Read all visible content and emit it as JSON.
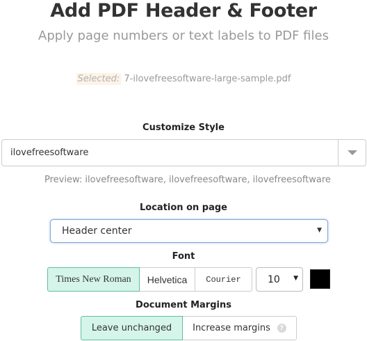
{
  "header": {
    "title": "Add PDF Header & Footer",
    "subtitle": "Apply page numbers or text labels to PDF files"
  },
  "file": {
    "selected_label": "Selected:",
    "filename": "7-ilovefreesoftware-large-sample.pdf"
  },
  "customize": {
    "label": "Customize Style",
    "value": "ilovefreesoftware",
    "preview": "Preview: ilovefreesoftware, ilovefreesoftware, ilovefreesoftware"
  },
  "location": {
    "label": "Location on page",
    "selected": "Header center"
  },
  "font": {
    "label": "Font",
    "options": [
      "Times New Roman",
      "Helvetica",
      "Courier"
    ],
    "selected": "Times New Roman",
    "size": "10",
    "color": "#000000"
  },
  "margins": {
    "label": "Document Margins",
    "options": [
      "Leave unchanged",
      "Increase margins"
    ],
    "selected": "Leave unchanged",
    "help_icon": "question-circle-icon"
  }
}
